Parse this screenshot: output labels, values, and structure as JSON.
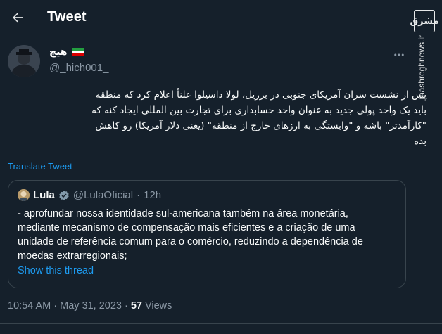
{
  "header": {
    "title": "Tweet"
  },
  "watermark": {
    "logo": "مشرق",
    "site": "mashreghnews.ir"
  },
  "author": {
    "name": "هیچ",
    "handle": "@_hich001_"
  },
  "tweet": {
    "lines": [
      "پس از نشست سران آمریکای جنوبی در برزیل، لولا داسیلوا علناً اعلام کرد که منطقه",
      "باید یک واحد پولی جدید به عنوان واحد حسابداری برای تجارت بین المللی ایجاد کنه که",
      "\"کارآمدتر\" باشه و \"وابستگی به ارزهای خارج از منطقه\" (یعنی دلار آمریکا) رو کاهش",
      "بده"
    ],
    "translate": "Translate Tweet"
  },
  "quote": {
    "name": "Lula",
    "handle": "@LulaOficial",
    "separator": "·",
    "time": "12h",
    "lines": [
      "- aprofundar nossa identidade sul-americana também na área monetária,",
      "mediante mecanismo de compensação mais eficientes e a criação de uma",
      "unidade de referência comum para o comércio, reduzindo a dependência de",
      "moedas extrarregionais;"
    ],
    "show_thread": "Show this thread"
  },
  "footer": {
    "time": "10:54 AM",
    "dot1": "·",
    "date": "May 31, 2023",
    "dot2": "·",
    "views_count": "57",
    "views_label": "Views"
  },
  "colors": {
    "background": "#15202b",
    "accent": "#1d9bf0",
    "muted": "#8b98a5",
    "verified": "#829aab"
  }
}
